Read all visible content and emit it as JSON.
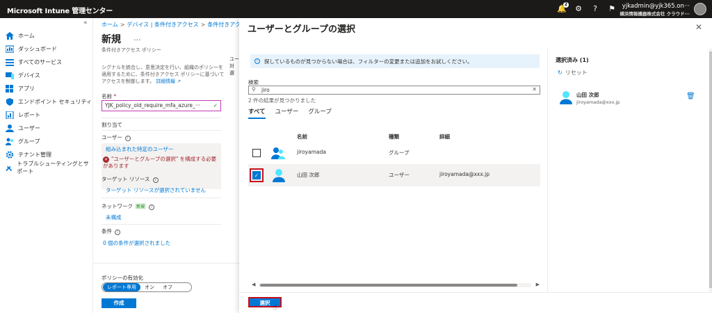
{
  "topbar": {
    "brand": "Microsoft Intune 管理センター",
    "notif_count": "2",
    "user": "yjkadmin@yjk365.on···",
    "org": "横浜情報機器株式会社 クラウド···"
  },
  "sidebar": {
    "items": [
      {
        "label": "ホーム",
        "icon": "home-icon"
      },
      {
        "label": "ダッシュボード",
        "icon": "dashboard-icon"
      },
      {
        "label": "すべてのサービス",
        "icon": "list-icon"
      },
      {
        "label": "デバイス",
        "icon": "device-icon"
      },
      {
        "label": "アプリ",
        "icon": "apps-icon"
      },
      {
        "label": "エンドポイント セキュリティ",
        "icon": "shield-icon"
      },
      {
        "label": "レポート",
        "icon": "report-icon"
      },
      {
        "label": "ユーザー",
        "icon": "user-icon"
      },
      {
        "label": "グループ",
        "icon": "group-icon"
      },
      {
        "label": "テナント管理",
        "icon": "tenant-icon"
      },
      {
        "label": "トラブルシューティングとサポート",
        "icon": "tools-icon"
      }
    ]
  },
  "policy": {
    "breadcrumb": [
      "ホーム",
      "デバイス | 条件付きアクセス",
      "条件付きアクセ"
    ],
    "title": "新規",
    "more": "...",
    "subtitle": "条件付きアクセス ポリシー",
    "description": "シグナルを統合し、意思決定を行い、組織のポリシーを適用するために、条件付きアクセス ポリシーに基づいてアクセスを制御します。",
    "details_link": "詳細情報",
    "name_label": "名前",
    "name_value": "YJK_policy_old_require_mfa_azure_···",
    "assign_label": "割り当て",
    "users_label": "ユーザー",
    "users_value": "組み込まれた特定のユーザー",
    "users_error": "\"ユーザーとグループの選択\" を構成する必要があります",
    "target_label": "ターゲット リソース",
    "target_value": "ターゲット リソースが選択されていません",
    "network_label": "ネットワーク",
    "network_badge": "新規",
    "network_value": "未構成",
    "conditions_label": "条件",
    "conditions_value": "0 個の条件が選択されました",
    "enable_label": "ポリシーの有効化",
    "toggle": [
      "レポート専用",
      "オン",
      "オフ"
    ],
    "create_btn": "作成"
  },
  "peek_text": "ユー 対 選",
  "panel": {
    "title": "ユーザーとグループの選択",
    "info": "探しているものが見つからない場合は、フィルターの変更または追加をお試しください。",
    "search_label": "検索",
    "search_value": "jiro",
    "result_count": "2 件の結果が見つかりました",
    "tabs": [
      "すべて",
      "ユーザー",
      "グループ"
    ],
    "columns": {
      "name": "名前",
      "type": "種類",
      "detail": "詳細"
    },
    "rows": [
      {
        "name": "jiroyamada",
        "type": "グループ",
        "detail": "",
        "checked": false
      },
      {
        "name": "山田 次郎",
        "type": "ユーザー",
        "detail": "jiroyamada@xxx.jp",
        "checked": true
      }
    ],
    "selected_header": "選択済み (1)",
    "reset": "リセット",
    "selected": {
      "name": "山田 次郎",
      "email": "jiroyamada@xxx.jp"
    },
    "select_btn": "選択"
  }
}
